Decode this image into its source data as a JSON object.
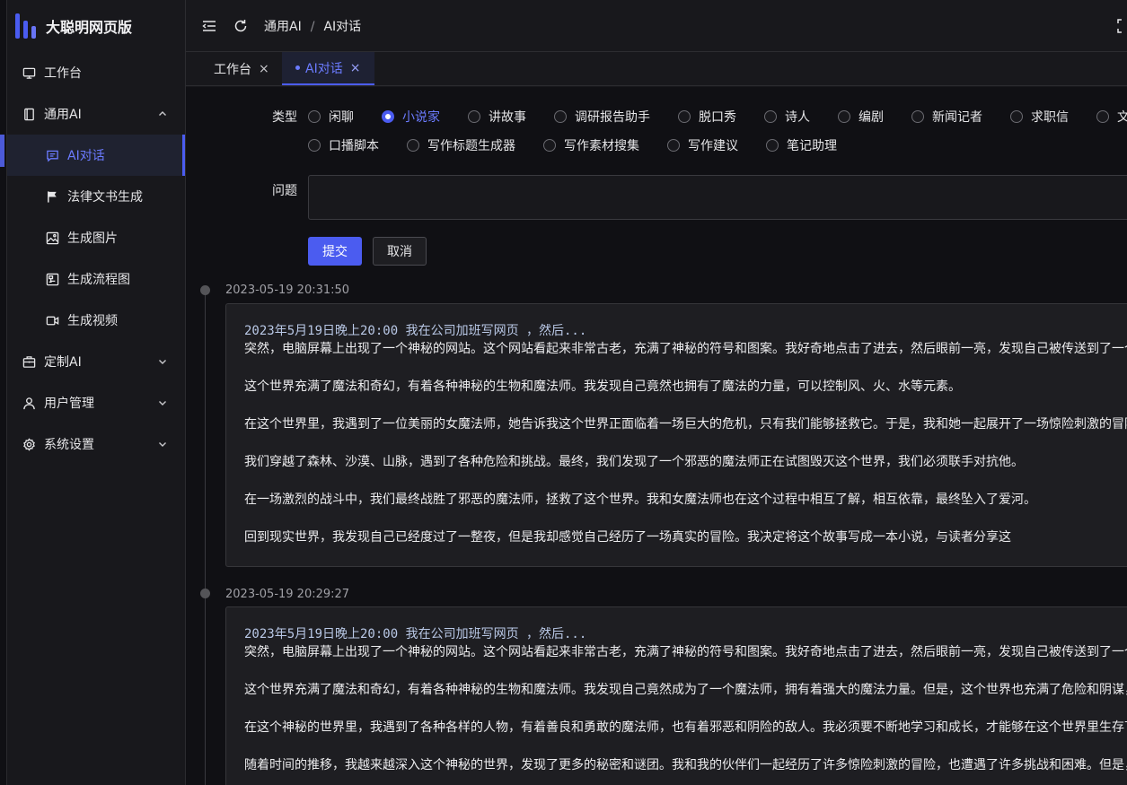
{
  "app": {
    "title": "大聪明网页版"
  },
  "sidebar": {
    "items": [
      {
        "label": "工作台"
      },
      {
        "label": "通用AI"
      },
      {
        "label": "AI对话"
      },
      {
        "label": "法律文书生成"
      },
      {
        "label": "生成图片"
      },
      {
        "label": "生成流程图"
      },
      {
        "label": "生成视频"
      },
      {
        "label": "定制AI"
      },
      {
        "label": "用户管理"
      },
      {
        "label": "系统设置"
      }
    ]
  },
  "header": {
    "breadcrumb": [
      "通用AI",
      "AI对话"
    ],
    "separator": "/"
  },
  "tabs": [
    {
      "label": "工作台",
      "close": "×"
    },
    {
      "label": "AI对话",
      "close": "×"
    }
  ],
  "form": {
    "type_label": "类型",
    "types": [
      "闲聊",
      "小说家",
      "讲故事",
      "调研报告助手",
      "脱口秀",
      "诗人",
      "编剧",
      "新闻记者",
      "求职信",
      "文",
      "口播脚本",
      "写作标题生成器",
      "写作素材搜集",
      "写作建议",
      "笔记助理"
    ],
    "selected_type": "小说家",
    "question_label": "问题",
    "question_value": "",
    "submit_label": "提交",
    "cancel_label": "取消"
  },
  "history": [
    {
      "time": "2023-05-19 20:31:50",
      "prompt": "2023年5月19日晚上20:00 我在公司加班写网页 ，然后...",
      "paragraphs": [
        "突然，电脑屏幕上出现了一个神秘的网站。这个网站看起来非常古老，充满了神秘的符号和图案。我好奇地点击了进去，然后眼前一亮，发现自己被传送到了一个",
        "这个世界充满了魔法和奇幻，有着各种神秘的生物和魔法师。我发现自己竟然也拥有了魔法的力量，可以控制风、火、水等元素。",
        "在这个世界里，我遇到了一位美丽的女魔法师，她告诉我这个世界正面临着一场巨大的危机，只有我们能够拯救它。于是，我和她一起展开了一场惊险刺激的冒险",
        "我们穿越了森林、沙漠、山脉，遇到了各种危险和挑战。最终，我们发现了一个邪恶的魔法师正在试图毁灭这个世界，我们必须联手对抗他。",
        "在一场激烈的战斗中，我们最终战胜了邪恶的魔法师，拯救了这个世界。我和女魔法师也在这个过程中相互了解，相互依靠，最终坠入了爱河。",
        "回到现实世界，我发现自己已经度过了一整夜，但是我却感觉自己经历了一场真实的冒险。我决定将这个故事写成一本小说，与读者分享这"
      ]
    },
    {
      "time": "2023-05-19 20:29:27",
      "prompt": "2023年5月19日晚上20:00 我在公司加班写网页 ，然后...",
      "paragraphs": [
        "突然，电脑屏幕上出现了一个神秘的网站。这个网站看起来非常古老，充满了神秘的符号和图案。我好奇地点击了进去，然后眼前一亮，发现自己被传送到了一个",
        "这个世界充满了魔法和奇幻，有着各种神秘的生物和魔法师。我发现自己竟然成为了一个魔法师，拥有着强大的魔法力量。但是，这个世界也充满了危险和阴谋，",
        "在这个神秘的世界里，我遇到了各种各样的人物，有着善良和勇敢的魔法师，也有着邪恶和阴险的敌人。我必须要不断地学习和成长，才能够在这个世界里生存下",
        "随着时间的推移，我越来越深入这个神秘的世界，发现了更多的秘密和谜团。我和我的伙伴们一起经历了许多惊险刺激的冒险，也遭遇了许多挑战和困难。但是，"
      ]
    }
  ],
  "colors": {
    "accent": "#4b5cf0",
    "accent_text": "#6b7bff",
    "bg": "#18181c",
    "content_bg": "#101014",
    "card_bg": "#1e1e22"
  }
}
